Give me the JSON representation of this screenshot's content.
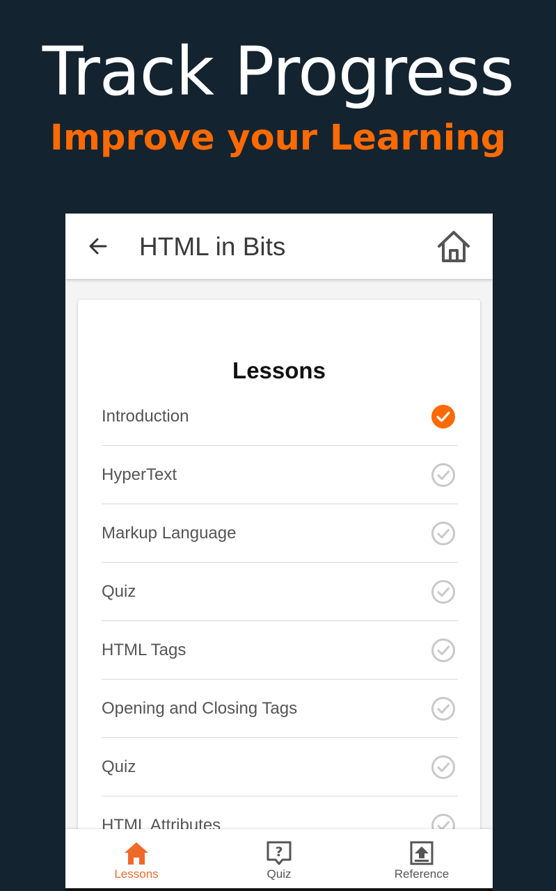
{
  "promo": {
    "title": "Track Progress",
    "subtitle": "Improve your Learning"
  },
  "app_bar": {
    "back_icon": "arrow-left-icon",
    "title": "HTML in Bits",
    "home_icon": "home-icon"
  },
  "card": {
    "title": "Lessons",
    "items": [
      {
        "label": "Introduction",
        "completed": true
      },
      {
        "label": "HyperText",
        "completed": false
      },
      {
        "label": "Markup Language",
        "completed": false
      },
      {
        "label": "Quiz",
        "completed": false
      },
      {
        "label": "HTML Tags",
        "completed": false
      },
      {
        "label": "Opening and Closing Tags",
        "completed": false
      },
      {
        "label": "Quiz",
        "completed": false
      },
      {
        "label": "HTML Attributes",
        "completed": false
      }
    ]
  },
  "bottom_nav": {
    "items": [
      {
        "label": "Lessons",
        "icon": "home-icon",
        "active": true
      },
      {
        "label": "Quiz",
        "icon": "question-box-icon",
        "active": false
      },
      {
        "label": "Reference",
        "icon": "upload-box-icon",
        "active": false
      }
    ]
  },
  "colors": {
    "background": "#13232f",
    "accent": "#ff6a00",
    "completed": "#ff6a00",
    "incomplete": "#c9c9c9",
    "nav_active": "#ef6a2a",
    "nav_inactive": "#555555"
  }
}
